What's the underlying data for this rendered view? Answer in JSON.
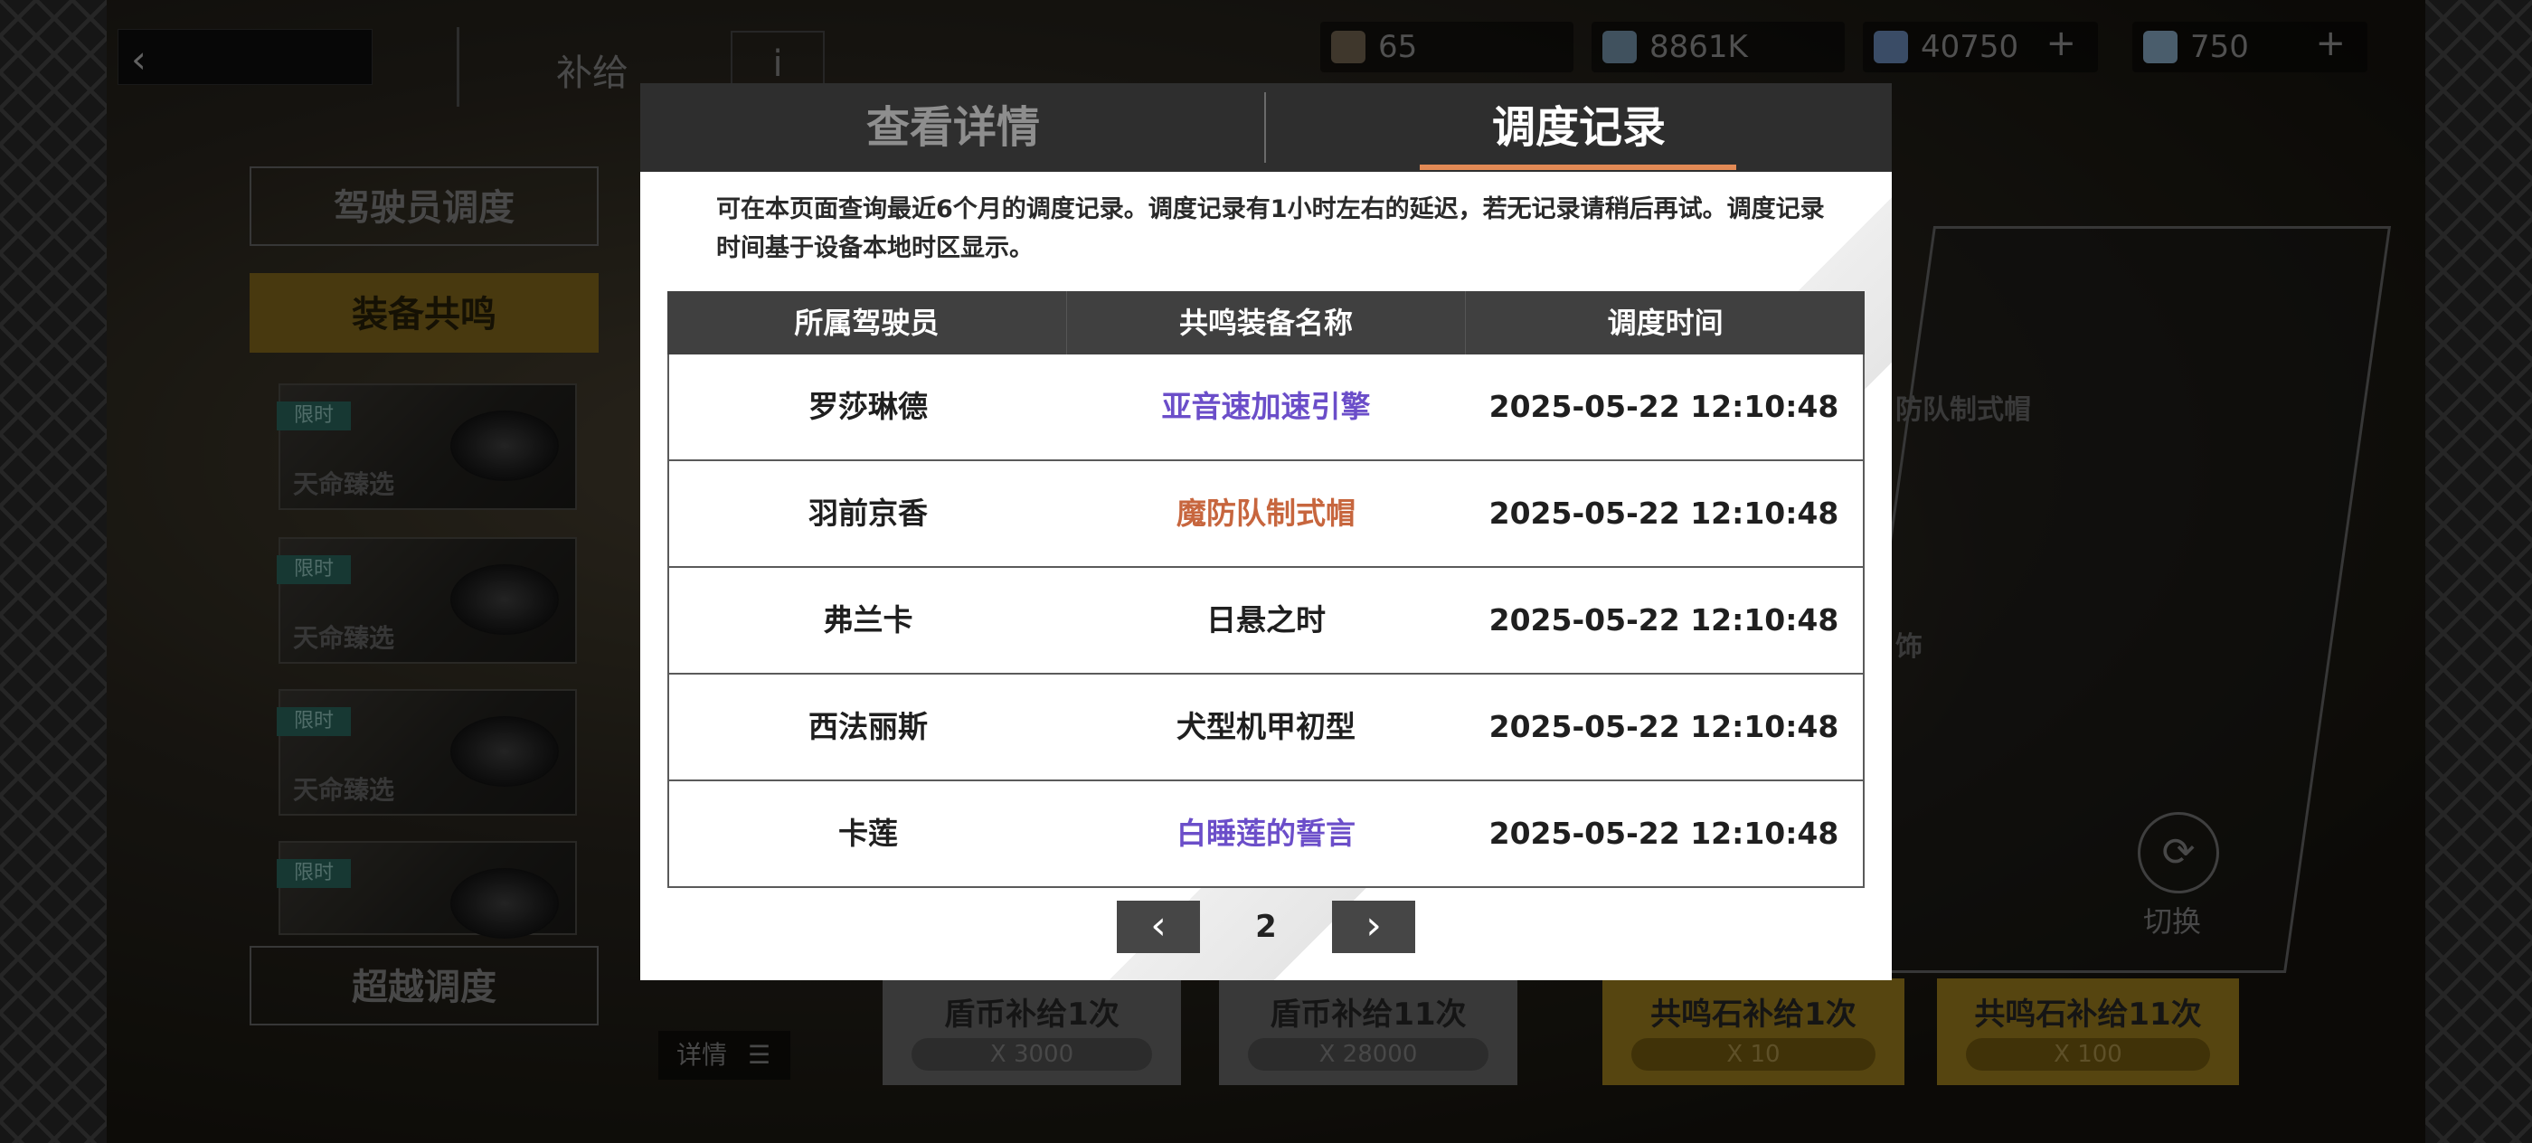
{
  "topbar": {
    "page_title": "补给",
    "info_label": "i",
    "resources": [
      {
        "value": "65",
        "icon": "supply-box-icon",
        "color": "#7a6a55"
      },
      {
        "value": "8861K",
        "icon": "shield-coin-ticket-icon",
        "color": "#7b9bb5"
      },
      {
        "value": "40750",
        "icon": "resonance-cube-icon",
        "color": "#6f93c4",
        "plus": "+"
      },
      {
        "value": "750",
        "icon": "crystal-icon",
        "color": "#8fb3d0",
        "plus": "+"
      }
    ]
  },
  "left_menu": {
    "pilot_dispatch": "驾驶员调度",
    "equip_resonance": "装备共鸣",
    "transcend_dispatch": "超越调度",
    "cards": [
      {
        "tag": "限时",
        "name": "天命臻选",
        "art": "hat-icon"
      },
      {
        "tag": "限时",
        "name": "天命臻选",
        "art": "gauntlet-icon"
      },
      {
        "tag": "限时",
        "name": "天命臻选",
        "art": "flower-icon"
      },
      {
        "tag": "限时",
        "name": "",
        "art": "cloth-icon"
      }
    ]
  },
  "detail_button": "详情",
  "bottom_actions": [
    {
      "label": "盾币补给1次",
      "cost": "X 3000",
      "style": "gray"
    },
    {
      "label": "盾币补给11次",
      "cost": "X 28000",
      "style": "gray"
    },
    {
      "label": "共鸣石补给1次",
      "cost": "X 10",
      "style": "gold"
    },
    {
      "label": "共鸣石补给11次",
      "cost": "X 100",
      "style": "gold"
    }
  ],
  "preview": {
    "label_1": "防队制式帽",
    "label_2": "饰",
    "switch_label": "切换"
  },
  "modal": {
    "tab_details": "查看详情",
    "tab_records": "调度记录",
    "notice": "可在本页面查询最近6个月的调度记录。调度记录有1小时左右的延迟，若无记录请稍后再试。调度记录时间基于设备本地时区显示。",
    "columns": [
      "所属驾驶员",
      "共鸣装备名称",
      "调度时间"
    ],
    "rows": [
      {
        "pilot": "罗莎琳德",
        "equipment": "亚音速加速引擎",
        "time": "2025-05-22 12:10:48",
        "rarity_color": "#6b4ec9"
      },
      {
        "pilot": "羽前京香",
        "equipment": "魔防队制式帽",
        "time": "2025-05-22 12:10:48",
        "rarity_color": "#c7663e"
      },
      {
        "pilot": "弗兰卡",
        "equipment": "日悬之时",
        "time": "2025-05-22 12:10:48",
        "rarity_color": "#1f1f1f"
      },
      {
        "pilot": "西法丽斯",
        "equipment": "犬型机甲初型",
        "time": "2025-05-22 12:10:48",
        "rarity_color": "#1f1f1f"
      },
      {
        "pilot": "卡莲",
        "equipment": "白睡莲的誓言",
        "time": "2025-05-22 12:10:48",
        "rarity_color": "#6b4ec9"
      }
    ],
    "page_number": "2",
    "prev_label": "‹",
    "next_label": "›"
  }
}
